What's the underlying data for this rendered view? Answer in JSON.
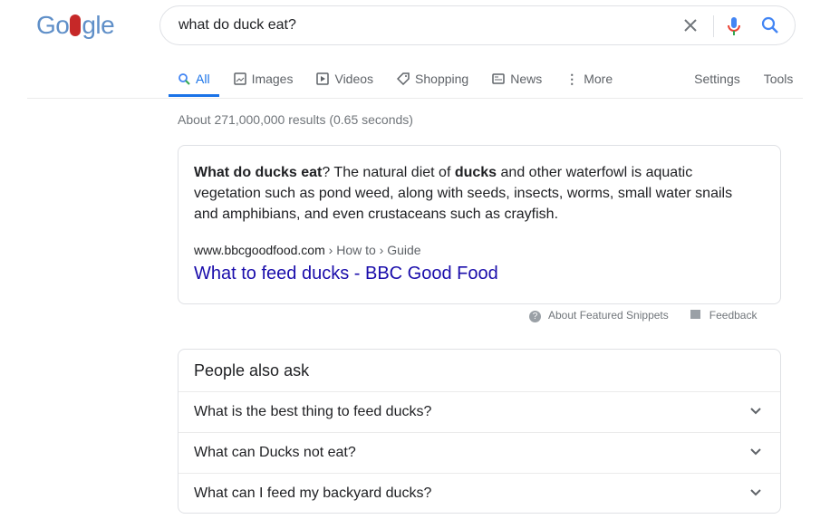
{
  "logo": {
    "before": "Go",
    "after": "gle"
  },
  "search": {
    "query": "what do duck eat?",
    "icons": [
      "clear-icon",
      "mic-icon",
      "search-icon"
    ]
  },
  "tabs": [
    {
      "label": "All",
      "icon": "search-icon",
      "active": true
    },
    {
      "label": "Images",
      "icon": "image-icon"
    },
    {
      "label": "Videos",
      "icon": "play-icon"
    },
    {
      "label": "Shopping",
      "icon": "tag-icon"
    },
    {
      "label": "News",
      "icon": "news-icon"
    },
    {
      "label": "More",
      "icon": "dots-vertical-icon"
    }
  ],
  "tools": {
    "settings": "Settings",
    "tools": "Tools"
  },
  "stats": "About 271,000,000 results (0.65 seconds)",
  "snippet": {
    "b1": "What do ducks eat",
    "t1": "? The natural diet of ",
    "b2": "ducks",
    "t2": " and other waterfowl is aquatic vegetation such as pond weed, along with seeds, insects, worms, small water snails and amphibians, and even crustaceans such as crayfish.",
    "site": "www.bbcgoodfood.com",
    "path": " › How to › Guide",
    "title": "What to feed ducks - BBC Good Food"
  },
  "meta": {
    "about": "About Featured Snippets",
    "feedback": "Feedback"
  },
  "paa": {
    "heading": "People also ask",
    "questions": [
      "What is the best thing to feed ducks?",
      "What can Ducks not eat?",
      "What can I feed my backyard ducks?"
    ]
  }
}
